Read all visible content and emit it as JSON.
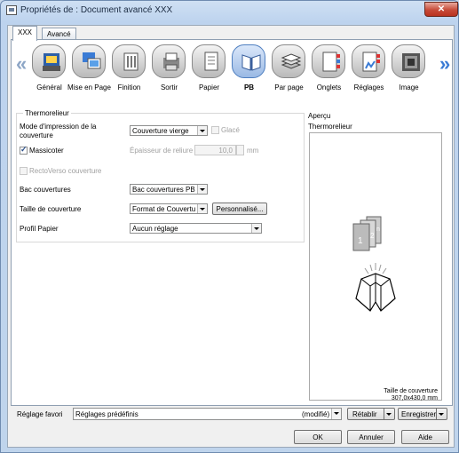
{
  "window": {
    "title": "Propriétés de : Document avancé XXX",
    "close_glyph": "✕"
  },
  "tabs": [
    {
      "label": "XXX",
      "active": true
    },
    {
      "label": "Avancé",
      "active": false
    }
  ],
  "nav": {
    "prev_glyph": "«",
    "next_glyph": "»",
    "icons": [
      {
        "label": "Général",
        "icon": "general-icon"
      },
      {
        "label": "Mise en Page",
        "icon": "layout-icon"
      },
      {
        "label": "Finition",
        "icon": "finishing-icon"
      },
      {
        "label": "Sortir",
        "icon": "output-icon"
      },
      {
        "label": "Papier",
        "icon": "paper-icon"
      },
      {
        "label": "PB",
        "icon": "perfect-binding-icon",
        "selected": true
      },
      {
        "label": "Par page",
        "icon": "per-page-icon"
      },
      {
        "label": "Onglets",
        "icon": "tabs-icon"
      },
      {
        "label": "Réglages",
        "icon": "settings-icon"
      },
      {
        "label": "Image",
        "icon": "image-icon"
      }
    ]
  },
  "settings": {
    "group_title": "Thermorelieur",
    "print_mode_label": "Mode d'impression de la couverture",
    "print_mode_value": "Couverture vierge",
    "glace_label": "Glacé",
    "massicoter_label": "Massicoter",
    "massicoter_checked": true,
    "thickness_label": "Épaisseur de reliure",
    "thickness_value": "10,0",
    "thickness_unit": "mm",
    "rectoverso_label": "RectoVerso couverture",
    "bac_label": "Bac couvertures",
    "bac_value": "Bac couvertures PB",
    "size_label": "Taille de couverture",
    "size_value": "Format de Couvertu",
    "custom_button": "Personnalisé...",
    "profile_label": "Profil Papier",
    "profile_value": "Aucun réglage"
  },
  "preview": {
    "title": "Aperçu",
    "subtitle": "Thermorelieur",
    "size_caption": "Taille de couverture",
    "size_value": "307,0x430,0 mm",
    "page_digits": [
      "1",
      "2",
      "n"
    ]
  },
  "favorites": {
    "label": "Réglage favori",
    "value": "Réglages prédéfinis",
    "status": "(modifié)",
    "restore_button": "Rétablir",
    "save_button": "Enregistrer"
  },
  "footer": {
    "ok": "OK",
    "cancel": "Annuler",
    "help": "Aide"
  }
}
